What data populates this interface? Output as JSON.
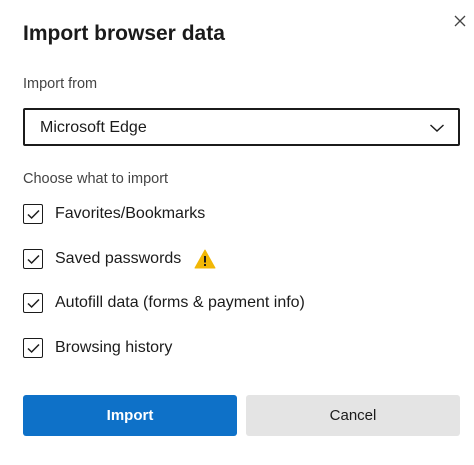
{
  "dialog": {
    "title": "Import browser data",
    "close_icon": "close-icon",
    "import_from": {
      "label": "Import from",
      "selected": "Microsoft Edge",
      "icon": "chevron-down-icon"
    },
    "choose_label": "Choose what to import",
    "options": [
      {
        "label": "Favorites/Bookmarks",
        "checked": true
      },
      {
        "label": "Saved passwords",
        "checked": true,
        "warning_icon": "warning-icon",
        "warning_color": "#f2b705"
      },
      {
        "label": "Autofill data (forms & payment info)",
        "checked": true
      },
      {
        "label": "Browsing history",
        "checked": true
      }
    ],
    "buttons": {
      "import_label": "Import",
      "cancel_label": "Cancel"
    }
  },
  "colors": {
    "primary": "#0e71c8",
    "secondary_bg": "#e4e4e4",
    "text": "#1b1b1b"
  }
}
